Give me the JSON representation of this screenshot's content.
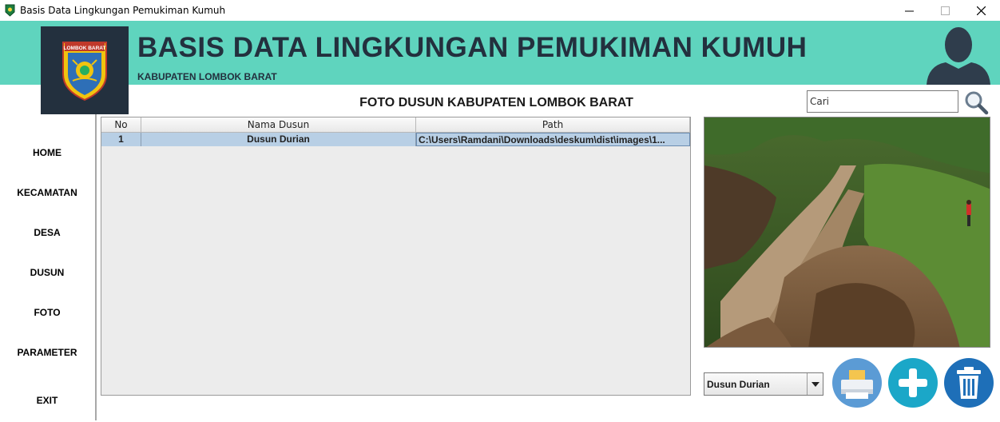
{
  "window": {
    "title": "Basis Data Lingkungan Pemukiman Kumuh",
    "minimize_glyph": "—",
    "maximize_glyph": "☐",
    "close_glyph": "✕"
  },
  "header": {
    "title": "BASIS DATA LINGKUNGAN PEMUKIMAN KUMUH",
    "subtitle": "KABUPATEN LOMBOK BARAT",
    "logo_text": "LOMBOK BARAT",
    "logo_icon": "emblem-icon",
    "user_icon": "user-avatar-icon",
    "colors": {
      "band": "#5fd4be",
      "dark": "#23303e"
    }
  },
  "sidebar": {
    "items": [
      {
        "label": "HOME"
      },
      {
        "label": "KECAMATAN"
      },
      {
        "label": "DESA"
      },
      {
        "label": "DUSUN"
      },
      {
        "label": "FOTO"
      },
      {
        "label": "PARAMETER"
      },
      {
        "label": "EXIT"
      }
    ]
  },
  "main": {
    "page_title": "FOTO DUSUN KABUPATEN LOMBOK BARAT",
    "search": {
      "value": "Cari",
      "icon": "search-icon"
    },
    "table": {
      "columns": [
        "No",
        "Nama Dusun",
        "Path"
      ],
      "rows": [
        {
          "no": "1",
          "nama": "Dusun Durian",
          "path": "C:\\Users\\Ramdani\\Downloads\\deskum\\dist\\images\\1..."
        }
      ],
      "selected_row_color": "#b8cfe5"
    },
    "photo": {
      "description_icon": "landslide-photo"
    },
    "dusun_select": {
      "value": "Dusun Durian"
    },
    "buttons": {
      "print_icon": "printer-icon",
      "add_icon": "plus-icon",
      "delete_icon": "trash-icon",
      "colors": {
        "print": "#5b9bd5",
        "add": "#1ba7c8",
        "delete": "#1e6fb8"
      }
    }
  }
}
